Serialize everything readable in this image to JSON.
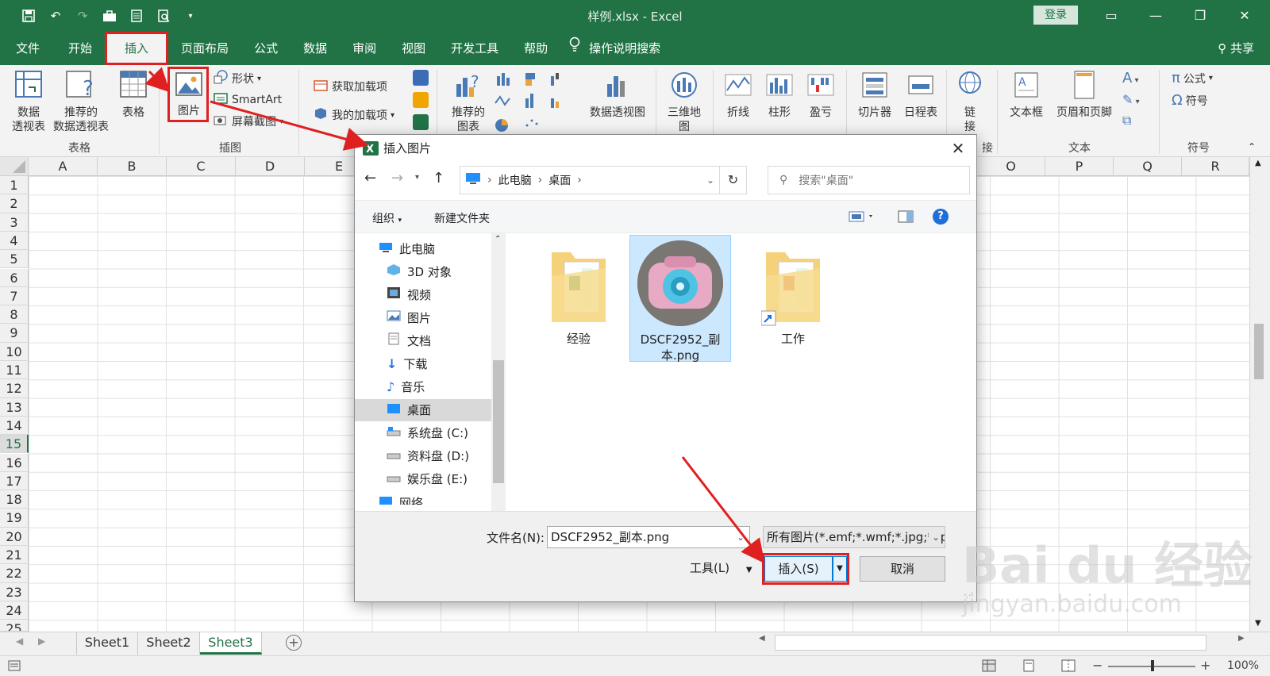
{
  "app": {
    "title": "样例.xlsx  -  Excel",
    "login": "登录",
    "share": "共享"
  },
  "tabs": [
    "文件",
    "开始",
    "插入",
    "页面布局",
    "公式",
    "数据",
    "审阅",
    "视图",
    "开发工具",
    "帮助"
  ],
  "tell_me": "操作说明搜索",
  "ribbon": {
    "pivot_table": "数据\n透视表",
    "recommended_pivot": "推荐的\n数据透视表",
    "table": "表格",
    "picture": "图片",
    "shapes": "形状",
    "smartart": "SmartArt",
    "screenshot": "屏幕截图",
    "get_addins": "获取加载项",
    "my_addins": "我的加载项",
    "recommended_charts": "推荐的\n图表",
    "pivot_chart": "数据透视图",
    "map_3d": "三维地\n图",
    "line": "折线",
    "column": "柱形",
    "win_loss": "盈亏",
    "slicer": "切片器",
    "timeline": "日程表",
    "link": "链\n接",
    "textbox": "文本框",
    "header_footer": "页眉和页脚",
    "equation": "公式",
    "symbol": "符号",
    "groups": {
      "tables": "表格",
      "illustrations": "插图",
      "links": "接",
      "text": "文本",
      "symbols": "符号"
    }
  },
  "columns": [
    "A",
    "B",
    "C",
    "D",
    "E",
    "O",
    "P",
    "Q",
    "R"
  ],
  "rows": [
    "1",
    "2",
    "3",
    "4",
    "5",
    "6",
    "7",
    "8",
    "9",
    "10",
    "11",
    "12",
    "13",
    "14",
    "15",
    "16",
    "17",
    "18",
    "19",
    "20",
    "21",
    "22",
    "23",
    "24",
    "25"
  ],
  "selected_row": "15",
  "sheets": [
    "Sheet1",
    "Sheet2",
    "Sheet3"
  ],
  "active_sheet": "Sheet3",
  "zoom": "100%",
  "dialog": {
    "title": "插入图片",
    "breadcrumb": [
      "此电脑",
      "桌面"
    ],
    "search_placeholder": "搜索\"桌面\"",
    "organize": "组织",
    "new_folder": "新建文件夹",
    "nav_items": [
      "此电脑",
      "3D 对象",
      "视频",
      "图片",
      "文档",
      "下载",
      "音乐",
      "桌面",
      "系统盘 (C:)",
      "资料盘 (D:)",
      "娱乐盘 (E:)",
      "网络"
    ],
    "selected_nav": "桌面",
    "files": [
      {
        "name": "经验",
        "type": "folder"
      },
      {
        "name": "DSCF2952_副本.png",
        "type": "image"
      },
      {
        "name": "工作",
        "type": "folder"
      }
    ],
    "filename_label": "文件名(N):",
    "filename_value": "DSCF2952_副本.png",
    "filetype_value": "所有图片(*.emf;*.wmf;*.jpg;*.jp",
    "tools": "工具(L)",
    "insert": "插入(S)",
    "cancel": "取消"
  },
  "watermark": {
    "main": "Bai du 经验",
    "sub": "jingyan.baidu.com"
  },
  "colors": {
    "excel_green": "#217346",
    "annotation_red": "#e02020",
    "selection_blue": "#cce8ff"
  }
}
